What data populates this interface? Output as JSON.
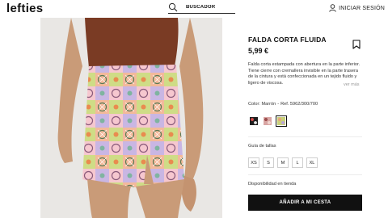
{
  "header": {
    "logo": "lefties",
    "search": {
      "label": "BUSCADOR",
      "icon": "search-icon"
    },
    "login": {
      "label": "INICIAR SESIÓN",
      "icon": "user-icon"
    }
  },
  "product": {
    "title": "FALDA CORTA FLUIDA",
    "price": "5,99 €",
    "description": "Falda corta estampada con abertura en la parte inferior. Tiene cierre con cremallera invisible en la parte trasera de la cintura y está confeccionada en un tejido fluido y ligero de viscosa.",
    "more_link": "ver más",
    "color_text": "Color: Marrón",
    "ref_text": "Ref. 5962/300/700",
    "swatches": [
      {
        "name": "dark-print",
        "colors": [
          "#1e1e1e",
          "#d84c4c",
          "#e6e6e6"
        ],
        "selected": false
      },
      {
        "name": "pink-print",
        "colors": [
          "#d9a6a4",
          "#9c4e4e",
          "#f1d5cf"
        ],
        "selected": false
      },
      {
        "name": "multicolor-print",
        "colors": [
          "#c9d17a",
          "#e9a37c",
          "#bba7d6"
        ],
        "selected": true
      }
    ],
    "size_guide": "Guía de tallas",
    "sizes": [
      "XS",
      "S",
      "M",
      "L",
      "XL"
    ],
    "stock_label": "Disponibilidad en tienda",
    "add_to_cart": "AÑADIR A MI CESTA",
    "bookmark_icon": "bookmark-icon"
  }
}
